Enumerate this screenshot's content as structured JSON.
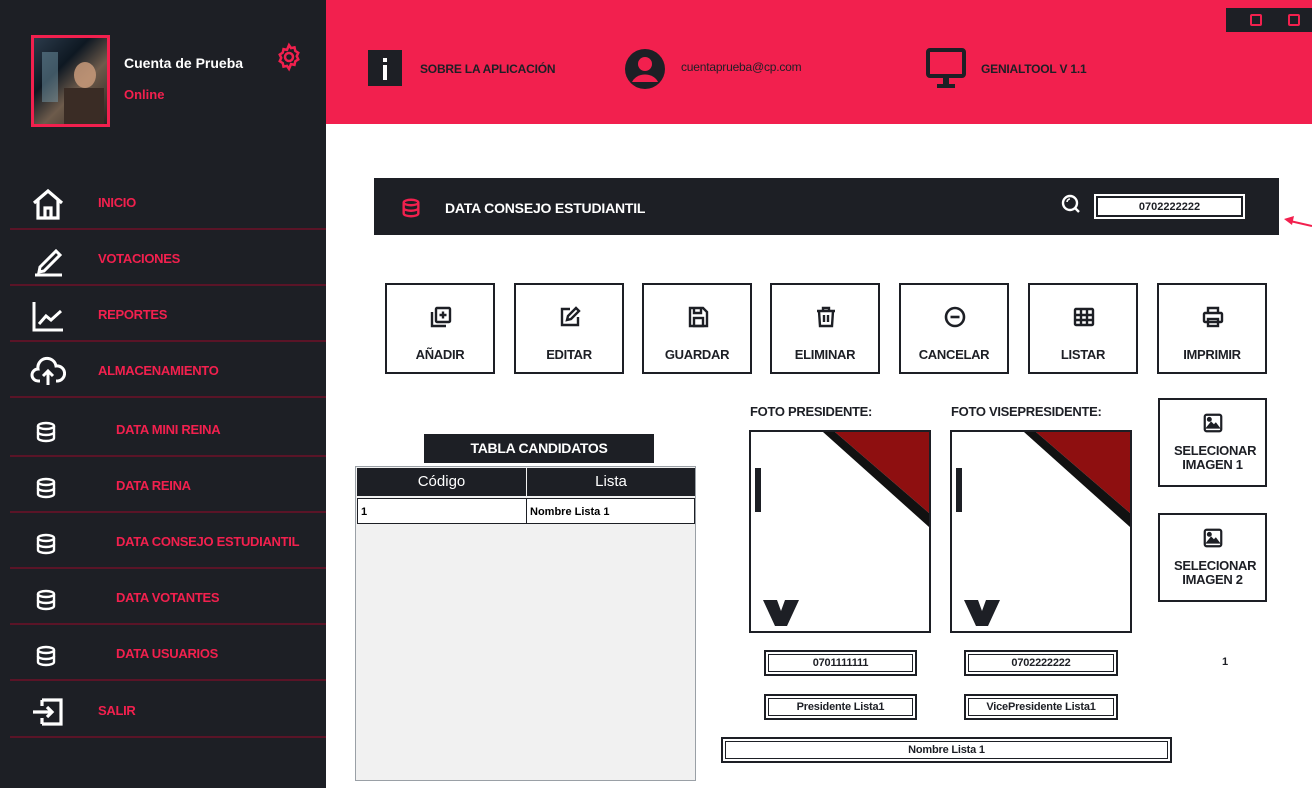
{
  "sidebar": {
    "user_name": "Cuenta de Prueba",
    "user_status": "Online",
    "items": [
      {
        "label": "INICIO",
        "icon": "home-icon"
      },
      {
        "label": "VOTACIONES",
        "icon": "pencil-icon"
      },
      {
        "label": "REPORTES",
        "icon": "chart-line-icon"
      },
      {
        "label": "ALMACENAMIENTO",
        "icon": "cloud-upload-icon"
      },
      {
        "label": "DATA MINI REINA",
        "icon": "database-icon"
      },
      {
        "label": "DATA REINA",
        "icon": "database-icon"
      },
      {
        "label": "DATA CONSEJO ESTUDIANTIL",
        "icon": "database-icon"
      },
      {
        "label": "DATA VOTANTES",
        "icon": "database-icon"
      },
      {
        "label": "DATA USUARIOS",
        "icon": "database-icon"
      },
      {
        "label": "SALIR",
        "icon": "logout-icon"
      }
    ]
  },
  "header": {
    "about": "SOBRE LA APLICACIÓN",
    "email": "cuentaprueba@cp.com",
    "version": "GENIALTOOL V 1.1"
  },
  "main": {
    "title": "DATA CONSEJO ESTUDIANTIL",
    "search_value": "0702222222",
    "actions": [
      "AÑADIR",
      "EDITAR",
      "GUARDAR",
      "ELIMINAR",
      "CANCELAR",
      "LISTAR",
      "IMPRIMIR"
    ],
    "table": {
      "title": "TABLA CANDIDATOS",
      "headers": [
        "Código",
        "Lista"
      ],
      "rows": [
        [
          "1",
          "Nombre Lista 1"
        ]
      ]
    },
    "photo_president_label": "FOTO PRESIDENTE:",
    "photo_vice_label": "FOTO VISEPRESIDENTE:",
    "select_image_1": "SELECIONAR IMAGEN 1",
    "select_image_2": "SELECIONAR IMAGEN 2",
    "president_id": "0701111111",
    "vice_id": "0702222222",
    "president_name": "Presidente Lista1",
    "vice_name": "VicePresidente Lista1",
    "list_name": "Nombre Lista 1",
    "count": "1"
  },
  "colors": {
    "accent": "#f2204e",
    "dark": "#1d1f25"
  }
}
